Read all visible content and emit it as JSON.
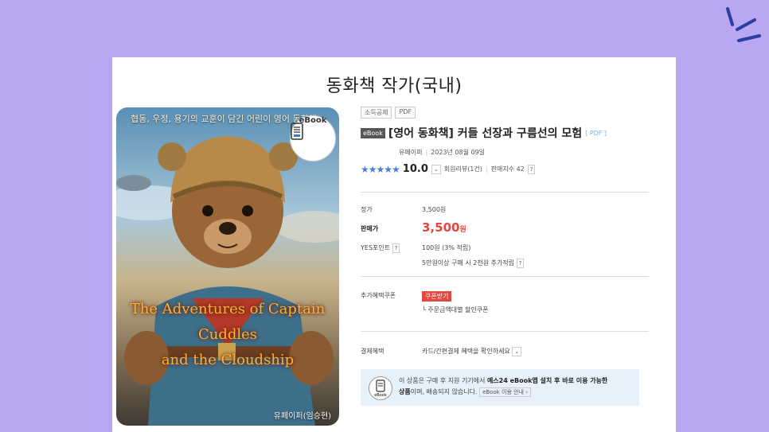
{
  "page": {
    "title": "동화책 작가(국내)",
    "colors": {
      "background": "#b9a7f3",
      "card": "#ffffff",
      "price": "#e5463f",
      "stars": "#4a7fd6"
    }
  },
  "cover": {
    "subtitle": "협동, 우정, 용기의 교훈이 담긴 어린이 영어 동화책",
    "title_line1": "The Adventures of Captain Cuddles",
    "title_line2": "and the Cloudship",
    "author": "유페이퍼(임승현)",
    "badge_label": "eBook",
    "badge_icon": "ebook-device-icon"
  },
  "product": {
    "tags": [
      "소득공제",
      "PDF"
    ],
    "format_tag": "eBook",
    "title": "[영어 동화책] 커들 선장과 구름선의 모험",
    "format_suffix": "[ PDF ]",
    "publisher": "유페이퍼",
    "date": "2023년 08월 09일",
    "stars": "★★★★★",
    "score": "10.0",
    "review_text": "회원리뷰(1건)",
    "sales_text": "판매지수 42",
    "help_mark": "?"
  },
  "pricing": {
    "list_label": "정가",
    "list_value": "3,500원",
    "sale_label": "판매가",
    "sale_value": "3,500",
    "sale_unit": "원",
    "points_label": "YES포인트",
    "points_value": "100원 (3% 적립)",
    "points_extra": "5만원이상 구매 시 2천원 추가적립"
  },
  "coupon": {
    "label": "추가혜택쿠폰",
    "button": "쿠폰받기",
    "desc": "└ 주문금액대별 할인쿠폰"
  },
  "payment": {
    "label": "결제혜택",
    "value": "카드/간편결제 혜택을 확인하세요"
  },
  "notice": {
    "line1_a": "이 상품은 구매 후 지원 기기에서 ",
    "line1_b": "예스24 eBook앱 설치 후 바로 이용 가능한",
    "line2_a": "상품",
    "line2_b": "이며, 배송되지 않습니다.",
    "guide_button": "eBook 이용 안내 ›",
    "icon_label": "eBook"
  }
}
